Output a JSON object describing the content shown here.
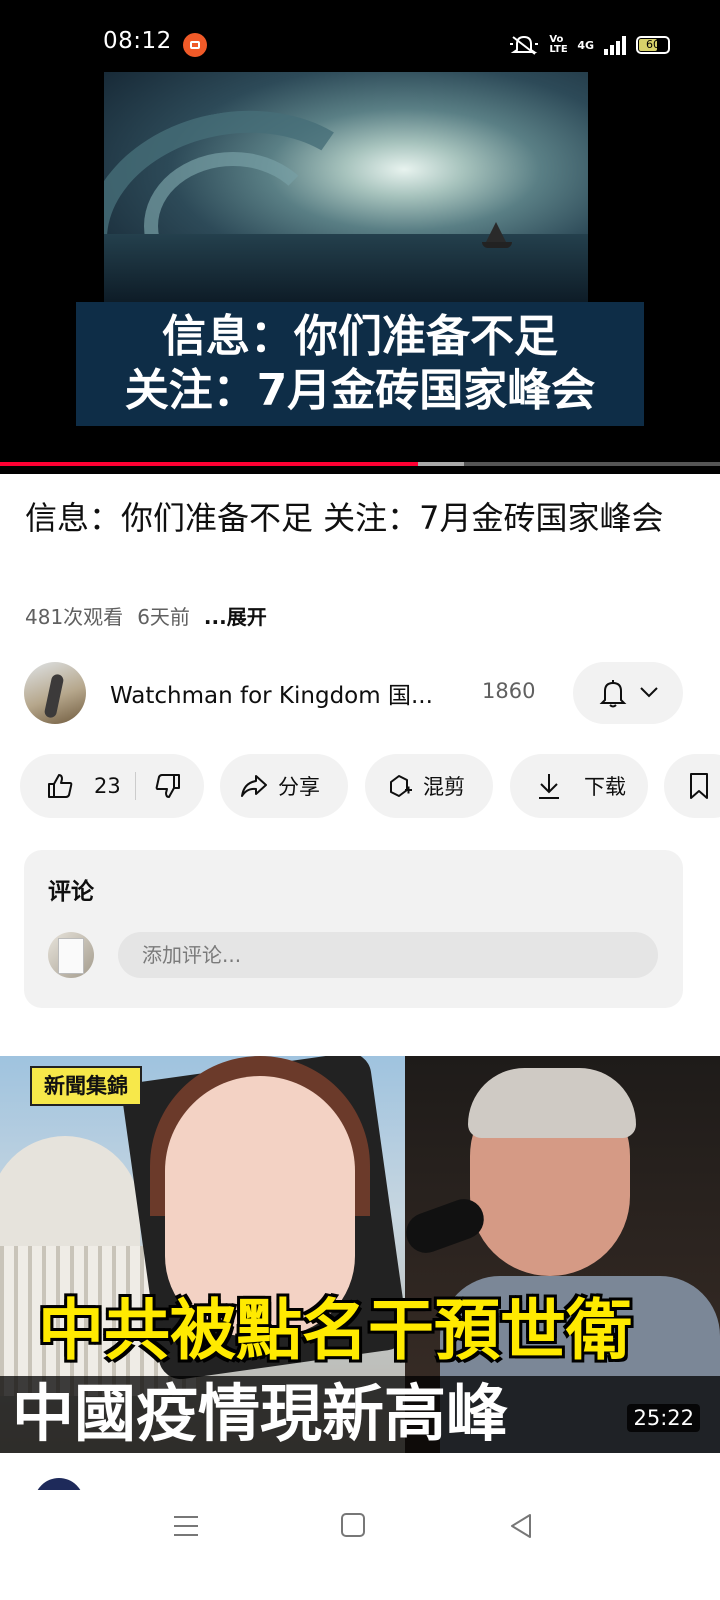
{
  "status_bar": {
    "time": "08:12",
    "network": "4G",
    "volte": "Vo LTE",
    "battery": "60"
  },
  "video": {
    "caption_line1": "信息：你们准备不足",
    "caption_line2": "关注：7月金砖国家峰会",
    "progress_fraction": 0.58,
    "buffered_fraction": 0.065
  },
  "title": "信息：你们准备不足 关注：7月金砖国家峰会",
  "meta": {
    "views": "481次观看",
    "age": "6天前",
    "more": "...展开"
  },
  "channel": {
    "name": "Watchman for Kingdom 国...",
    "subscribers": "1860"
  },
  "actions": {
    "likes": "23",
    "share": "分享",
    "remix": "混剪",
    "download": "下载"
  },
  "comments": {
    "title": "评论",
    "placeholder": "添加评论..."
  },
  "next_video": {
    "badge": "新聞集錦",
    "headline1": "中共被點名干預世衛",
    "headline2": "中國疫情現新高峰",
    "duration": "25:22"
  },
  "colors": {
    "accent": "#ff0033",
    "caption_bg": "#0e2d47",
    "pill_bg": "#f2f2f2",
    "headline_yellow": "#ffea00"
  },
  "icons": [
    "rec-icon",
    "mute-icon",
    "signal-icon",
    "battery-icon",
    "bell-icon",
    "chevron-down-icon",
    "thumbs-up-icon",
    "thumbs-down-icon",
    "share-icon",
    "remix-icon",
    "download-icon",
    "save-icon",
    "menu-icon",
    "home-icon",
    "back-icon"
  ]
}
